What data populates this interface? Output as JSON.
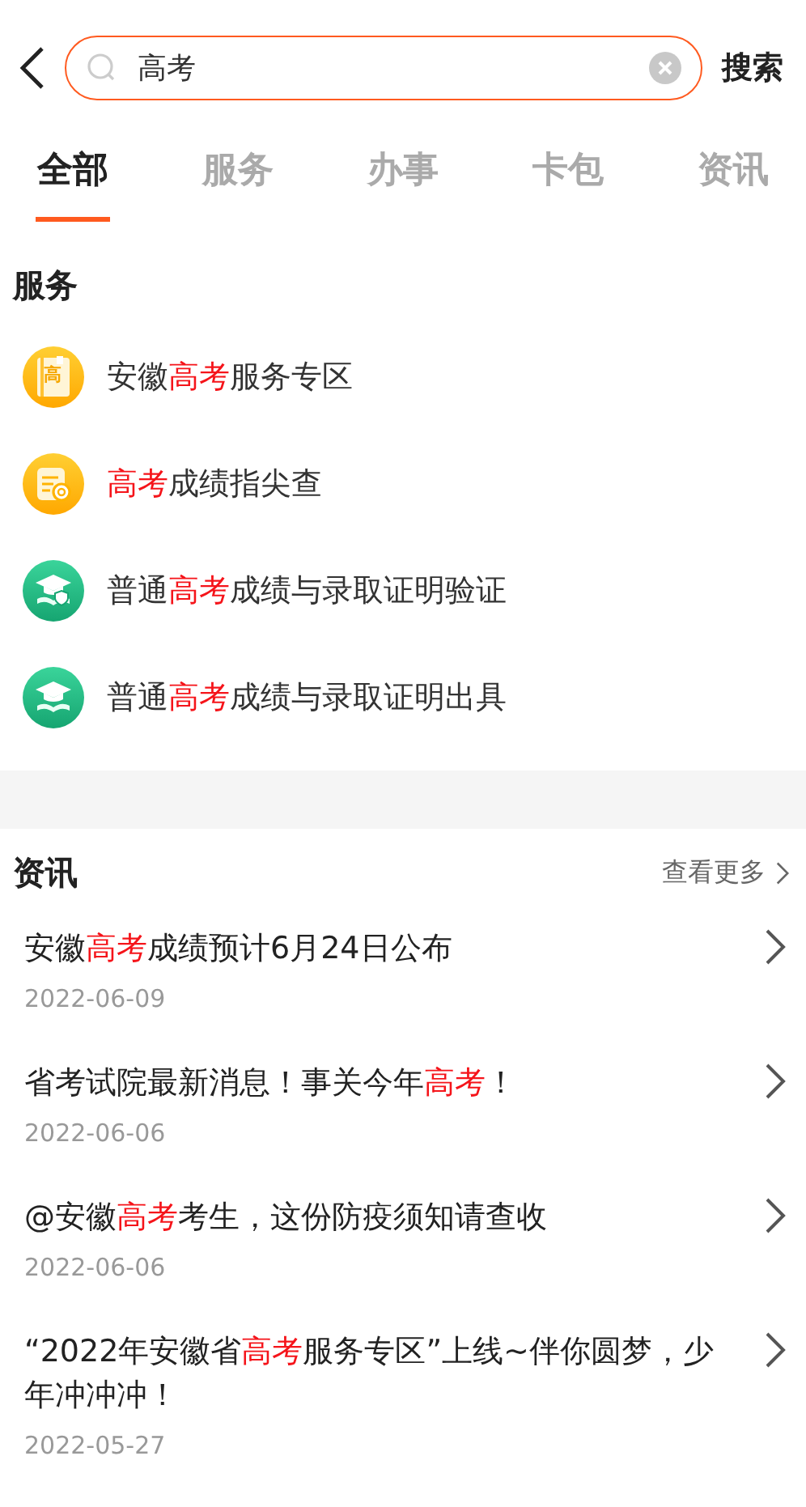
{
  "search": {
    "value": "高考",
    "button": "搜索"
  },
  "tabs": [
    {
      "label": "全部",
      "selected": true
    },
    {
      "label": "服务",
      "selected": false
    },
    {
      "label": "办事",
      "selected": false
    },
    {
      "label": "卡包",
      "selected": false
    },
    {
      "label": "资讯",
      "selected": false
    }
  ],
  "services": {
    "title": "服务",
    "items": [
      {
        "kind": "notebook",
        "icon_text": "高",
        "title": [
          {
            "text": "安徽",
            "highlight": false
          },
          {
            "text": "高考",
            "highlight": true
          },
          {
            "text": "服务专区",
            "highlight": false
          }
        ]
      },
      {
        "kind": "report",
        "title": [
          {
            "text": "高考",
            "highlight": true
          },
          {
            "text": "成绩指尖查",
            "highlight": false
          }
        ]
      },
      {
        "kind": "cap-shield",
        "title": [
          {
            "text": "普通",
            "highlight": false
          },
          {
            "text": "高考",
            "highlight": true
          },
          {
            "text": "成绩与录取证明验证",
            "highlight": false
          }
        ]
      },
      {
        "kind": "cap-book",
        "title": [
          {
            "text": "普通",
            "highlight": false
          },
          {
            "text": "高考",
            "highlight": true
          },
          {
            "text": "成绩与录取证明出具",
            "highlight": false
          }
        ]
      }
    ]
  },
  "news": {
    "title": "资讯",
    "more": "查看更多",
    "items": [
      {
        "title": [
          {
            "text": "安徽",
            "highlight": false
          },
          {
            "text": "高考",
            "highlight": true
          },
          {
            "text": "成绩预计6月24日公布",
            "highlight": false
          }
        ],
        "date": "2022-06-09"
      },
      {
        "title": [
          {
            "text": "省考试院最新消息！事关今年",
            "highlight": false
          },
          {
            "text": "高考",
            "highlight": true
          },
          {
            "text": "！",
            "highlight": false
          }
        ],
        "date": "2022-06-06"
      },
      {
        "title": [
          {
            "text": "@安徽",
            "highlight": false
          },
          {
            "text": "高考",
            "highlight": true
          },
          {
            "text": "考生，这份防疫须知请查收",
            "highlight": false
          }
        ],
        "date": "2022-06-06"
      },
      {
        "title": [
          {
            "text": "“2022年安徽省",
            "highlight": false
          },
          {
            "text": "高考",
            "highlight": true
          },
          {
            "text": "服务专区”上线~伴你圆梦，少年冲冲冲！",
            "highlight": false
          }
        ],
        "date": "2022-05-27"
      }
    ]
  }
}
